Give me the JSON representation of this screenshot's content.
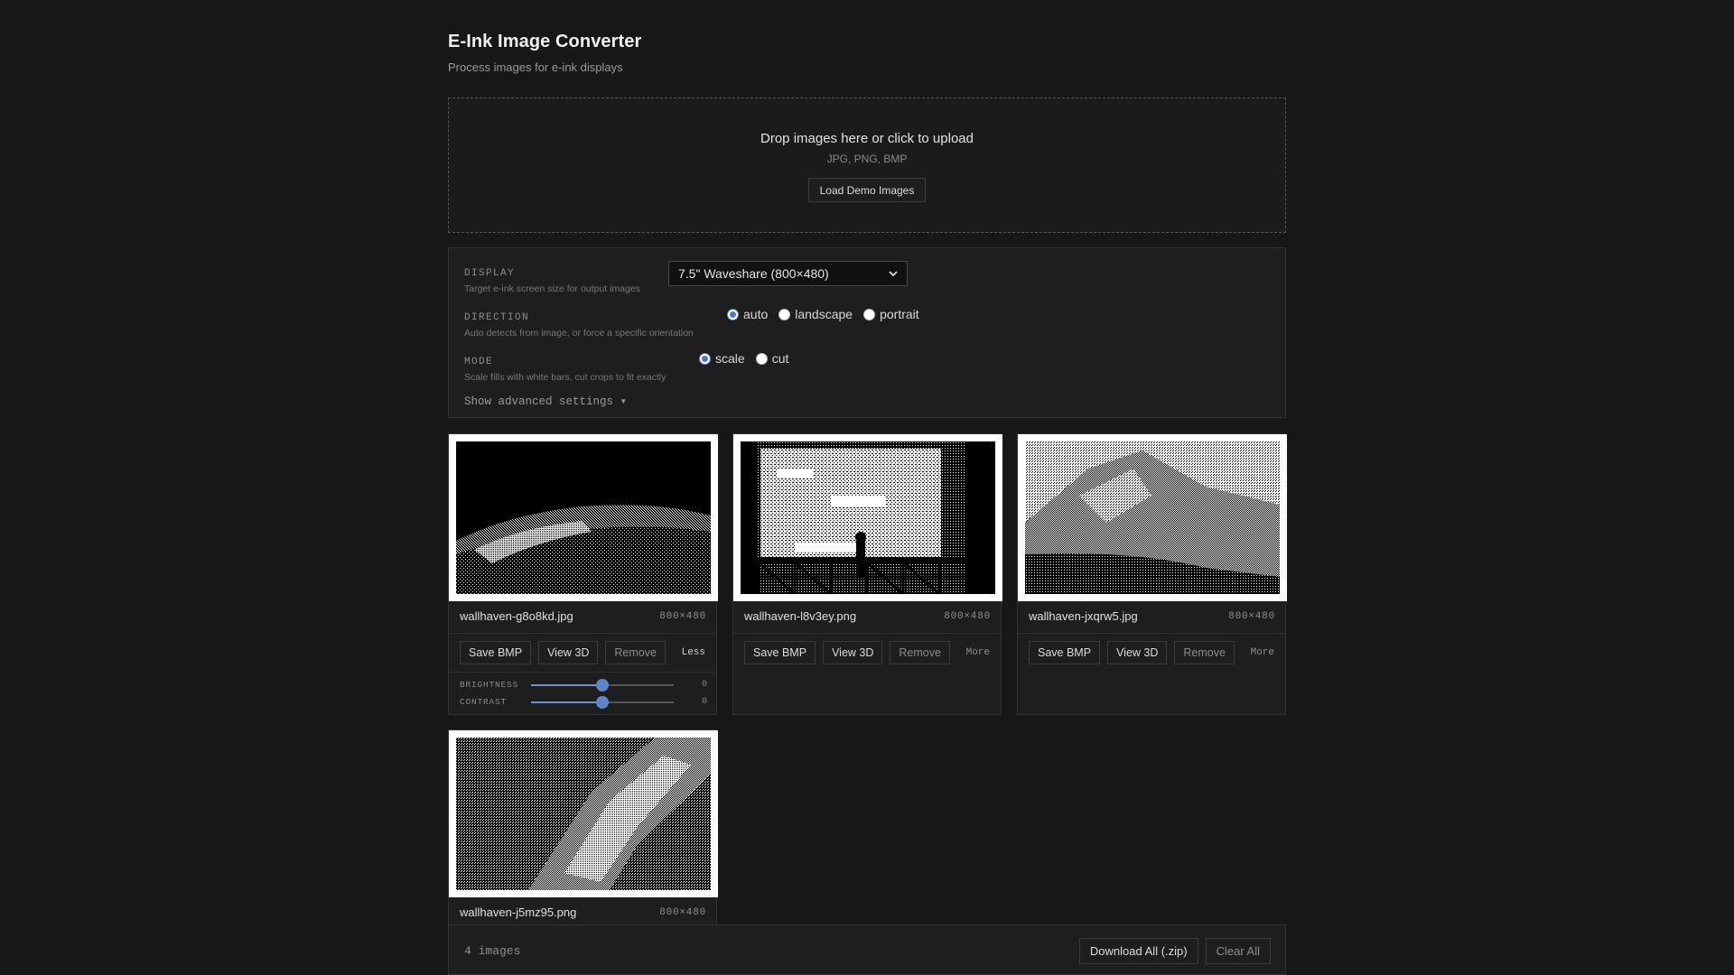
{
  "header": {
    "title": "E-Ink Image Converter",
    "subtitle": "Process images for e-ink displays"
  },
  "upload": {
    "title": "Drop images here or click to upload",
    "formats": "JPG, PNG, BMP",
    "demo_label": "Load Demo Images"
  },
  "settings": {
    "display": {
      "label": "DISPLAY",
      "description": "Target e-ink screen size for output images",
      "selected": "7.5\" Waveshare (800×480)"
    },
    "direction": {
      "label": "DIRECTION",
      "description": "Auto detects from image, or force a specific orientation",
      "options": [
        "auto",
        "landscape",
        "portrait"
      ],
      "selected": "auto"
    },
    "mode": {
      "label": "MODE",
      "description": "Scale fills with white bars, cut crops to fit exactly",
      "options": [
        "scale",
        "cut"
      ],
      "selected": "scale"
    },
    "advanced_toggle": "Show advanced settings ▾"
  },
  "card_labels": {
    "save": "Save BMP",
    "view3d": "View 3D",
    "remove": "Remove",
    "less": "Less",
    "more": "More",
    "brightness": "BRIGHTNESS",
    "contrast": "CONTRAST"
  },
  "images": [
    {
      "name": "wallhaven-g8o8kd.jpg",
      "dims": "800×480",
      "expanded": true,
      "brightness": "0",
      "contrast": "0",
      "brightness_level": 0.5,
      "contrast_level": 0.5
    },
    {
      "name": "wallhaven-l8v3ey.png",
      "dims": "800×480",
      "expanded": false
    },
    {
      "name": "wallhaven-jxqrw5.jpg",
      "dims": "800×480",
      "expanded": false
    },
    {
      "name": "wallhaven-j5mz95.png",
      "dims": "800×480",
      "expanded": false
    }
  ],
  "footer": {
    "count": "4 images",
    "download_label": "Download All (.zip)",
    "clear_label": "Clear All"
  },
  "colors": {
    "background": "#171717",
    "panel": "#1e1e1e",
    "accent": "#5b86c9"
  }
}
